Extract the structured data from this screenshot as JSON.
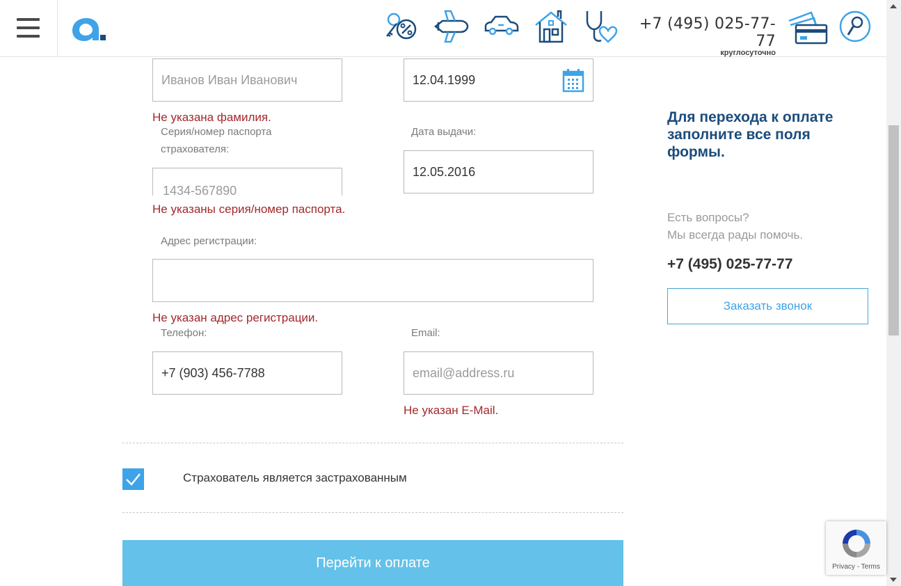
{
  "header": {
    "phone": "+7 (495) 025-77-77",
    "phone_note": "круглосуточно",
    "icons": [
      "menu-icon",
      "discount-key-icon",
      "plane-icon",
      "car-icon",
      "house-icon",
      "stethoscope-icon",
      "cards-icon",
      "search-icon"
    ]
  },
  "form": {
    "fio_value": "Иванов Иван Иванович",
    "fio_error": "Не указана фамилия.",
    "birthdate_value": "12.04.1999",
    "passport_label_1": "Серия/номер паспорта",
    "passport_label_2": "страхователя:",
    "passport_placeholder": "1434-567890",
    "passport_error": "Не указаны серия/номер паспорта.",
    "issue_date_label": "Дата выдачи:",
    "issue_date_value": "12.05.2016",
    "address_label": "Адрес регистрации:",
    "address_value": "",
    "address_error": "Не указан адрес регистрации.",
    "phone_label": "Телефон:",
    "phone_value": "+7 (903) 456-7788",
    "email_label": "Email:",
    "email_placeholder": "email@address.ru",
    "email_error": "Не указан E-Mail.",
    "insured_checkbox_label": "Страхователь является застрахованным",
    "insured_checked": true,
    "pay_button": "Перейти к оплате"
  },
  "sidebar": {
    "heading_1": "Для перехода к оплате",
    "heading_2": "заполните все поля",
    "heading_3": "формы.",
    "question_1": "Есть вопросы?",
    "question_2": "Мы всегда рады помочь.",
    "phone": "+7 (495) 025-77-77",
    "call_button": "Заказать звонок"
  },
  "recaptcha": {
    "links": "Privacy - Terms"
  },
  "colors": {
    "brand_blue": "#3ea3e8",
    "dark_blue": "#1b4c7b",
    "error_red": "#a3282c",
    "button_blue": "#63c1ea"
  }
}
